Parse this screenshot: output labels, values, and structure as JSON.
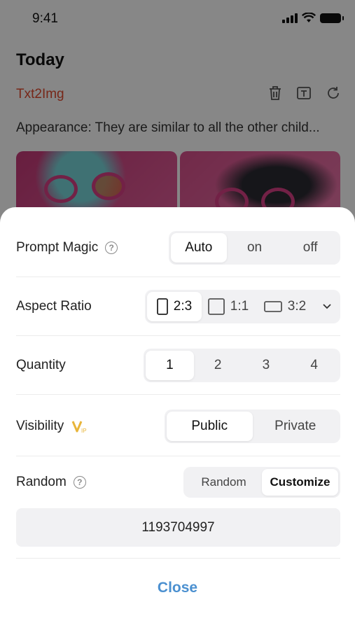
{
  "status": {
    "time": "9:41"
  },
  "background": {
    "section_title": "Today",
    "mode": "Txt2Img",
    "prompt": "Appearance: They are similar to all the other child...",
    "tool_icons": [
      "trash-icon",
      "text-icon",
      "refresh-icon"
    ]
  },
  "sheet": {
    "prompt_magic": {
      "label": "Prompt Magic",
      "options": [
        "Auto",
        "on",
        "off"
      ],
      "selected": "Auto"
    },
    "aspect_ratio": {
      "label": "Aspect Ratio",
      "options": [
        "2:3",
        "1:1",
        "3:2"
      ],
      "selected": "2:3"
    },
    "quantity": {
      "label": "Quantity",
      "options": [
        "1",
        "2",
        "3",
        "4"
      ],
      "selected": "1"
    },
    "visibility": {
      "label": "Visibility",
      "options": [
        "Public",
        "Private"
      ],
      "selected": "Public"
    },
    "random": {
      "label": "Random",
      "options": [
        "Random",
        "Customize"
      ],
      "selected": "Customize"
    },
    "seed_value": "1193704997",
    "close_label": "Close"
  },
  "colors": {
    "accent_blue": "#4b90d0",
    "mode_red": "#e04a2f",
    "vip_gold": "#e8b53a"
  }
}
